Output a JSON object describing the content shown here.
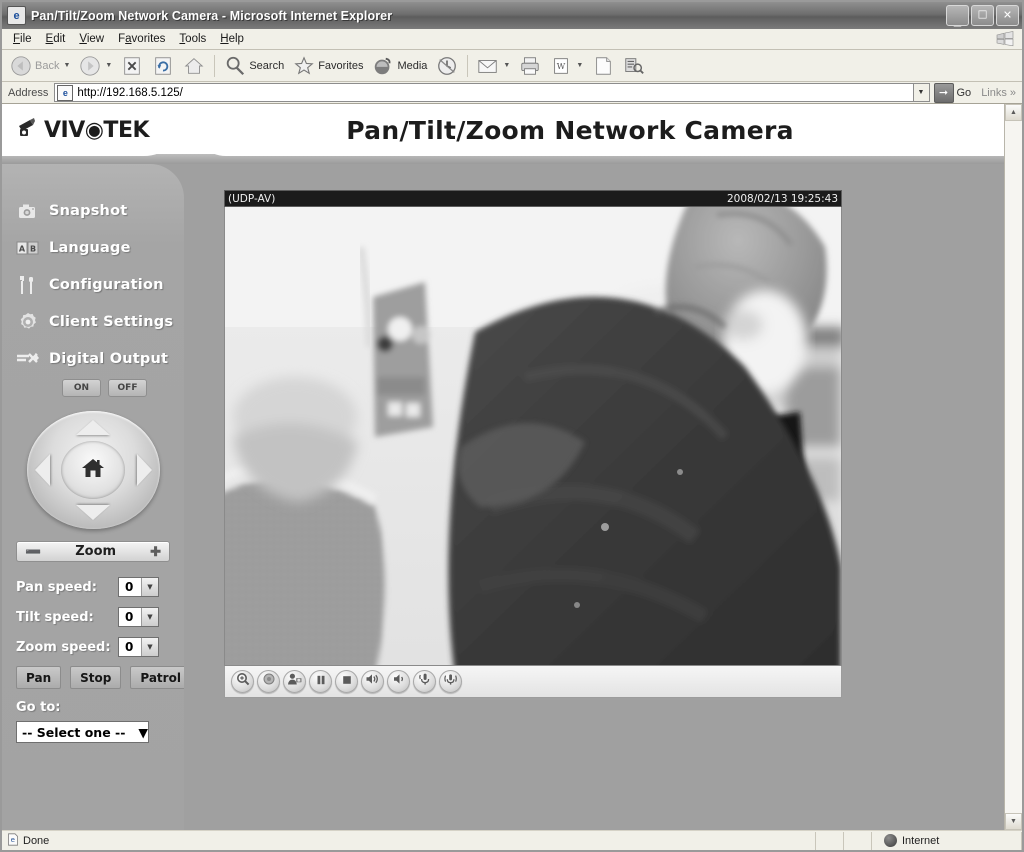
{
  "window": {
    "title": "Pan/Tilt/Zoom Network Camera - Microsoft Internet Explorer",
    "icon": "ie-document-icon",
    "minimize": "_",
    "maximize": "❐",
    "close": "✕"
  },
  "menubar": {
    "items": [
      {
        "label": "File",
        "accel": "F"
      },
      {
        "label": "Edit",
        "accel": "E"
      },
      {
        "label": "View",
        "accel": "V"
      },
      {
        "label": "Favorites",
        "accel": "a"
      },
      {
        "label": "Tools",
        "accel": "T"
      },
      {
        "label": "Help",
        "accel": "H"
      }
    ]
  },
  "toolbar": {
    "back_label": "Back",
    "forward_label": "",
    "stop_label": "",
    "refresh_label": "",
    "home_label": "",
    "search_label": "Search",
    "favorites_label": "Favorites",
    "media_label": "Media",
    "history_label": "",
    "mail_label": "",
    "print_label": "",
    "edit_label": "",
    "messenger_label": "",
    "discuss_label": ""
  },
  "address": {
    "label": "Address",
    "url": "http://192.168.5.125/",
    "go_label": "Go",
    "links_label": "Links",
    "links_chevron": "»"
  },
  "brand": {
    "logo_text": "VIV◉TEK",
    "page_title": "Pan/Tilt/Zoom Network Camera"
  },
  "sidebar": {
    "items": [
      {
        "label": "Snapshot",
        "icon": "camera-icon"
      },
      {
        "label": "Language",
        "icon": "ab-book-icon"
      },
      {
        "label": "Configuration",
        "icon": "tools-icon"
      },
      {
        "label": "Client Settings",
        "icon": "gear-icon"
      },
      {
        "label": "Digital Output",
        "icon": "signal-icon"
      }
    ],
    "digital_output": {
      "on_label": "ON",
      "off_label": "OFF"
    },
    "ptz_pad": {
      "home_icon": "home-icon",
      "up_icon": "arrow-up-icon",
      "down_icon": "arrow-down-icon",
      "left_icon": "arrow-left-icon",
      "right_icon": "arrow-right-icon"
    },
    "zoom_bar": {
      "label": "Zoom",
      "minus": "➖",
      "plus": "✚"
    },
    "speeds": [
      {
        "label": "Pan speed:",
        "value": "0"
      },
      {
        "label": "Tilt speed:",
        "value": "0"
      },
      {
        "label": "Zoom speed:",
        "value": "0"
      }
    ],
    "action_buttons": [
      {
        "label": "Pan"
      },
      {
        "label": "Stop"
      },
      {
        "label": "Patrol"
      }
    ],
    "goto": {
      "label": "Go to:",
      "selected": "-- Select one --"
    }
  },
  "video": {
    "stream_mode": "(UDP-AV)",
    "timestamp": "2008/02/13 19:25:43",
    "controls": [
      {
        "name": "digital-zoom-button",
        "icon": "magnifier-plus-icon"
      },
      {
        "name": "record-button",
        "icon": "record-circle-icon"
      },
      {
        "name": "snapshot-button",
        "icon": "person-camera-icon"
      },
      {
        "name": "pause-button",
        "icon": "pause-icon"
      },
      {
        "name": "stop-button",
        "icon": "stop-square-icon"
      },
      {
        "name": "volume-up-button",
        "icon": "speaker-waves-icon"
      },
      {
        "name": "volume-mute-button",
        "icon": "speaker-icon"
      },
      {
        "name": "microphone-button",
        "icon": "microphone-icon"
      },
      {
        "name": "talk-button",
        "icon": "mic-waves-icon"
      }
    ]
  },
  "statusbar": {
    "status": "Done",
    "zone": "Internet",
    "zone_icon": "globe-icon"
  },
  "colors": {
    "titlebar": "#6e6e6e",
    "sidebar": "#a8a8a8",
    "banner": "#ffffff",
    "content_bg": "#9b9b9b",
    "video_header": "#1b1b1b"
  }
}
